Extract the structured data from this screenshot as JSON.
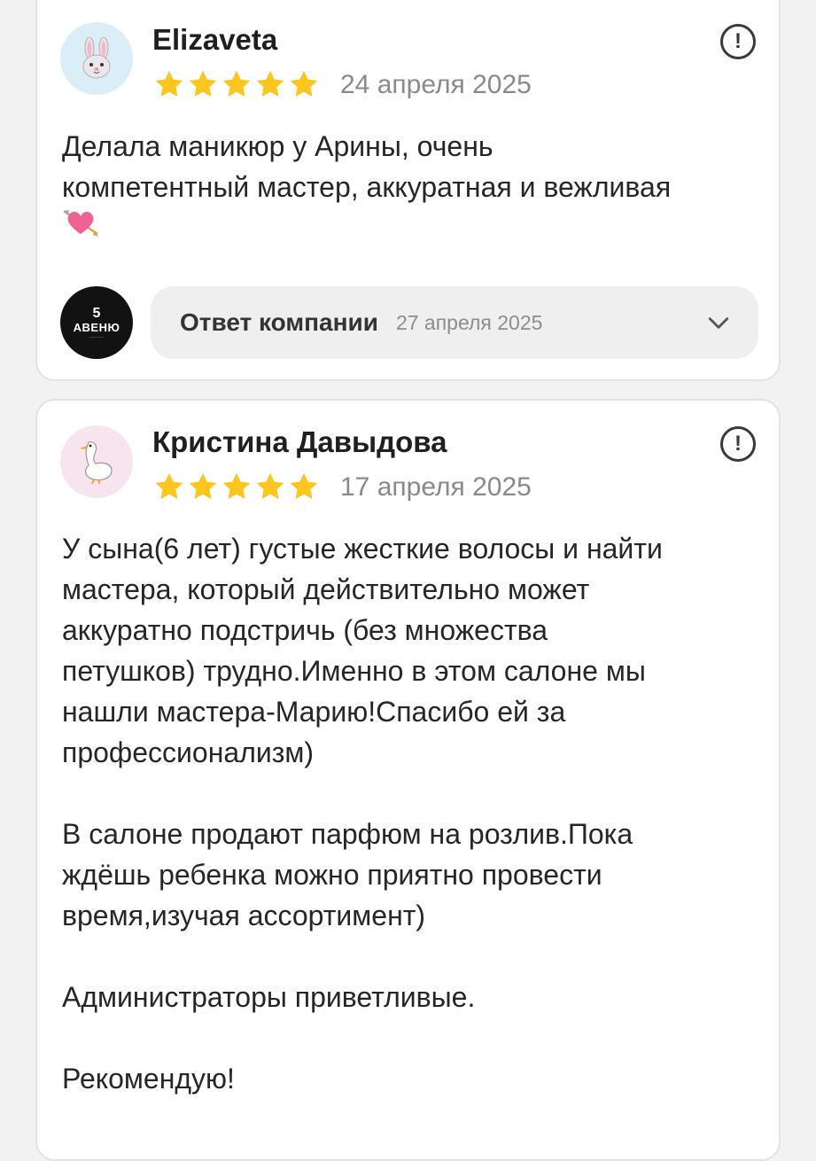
{
  "colors": {
    "star": "#fcc61e",
    "card_bg": "#ffffff",
    "page_bg": "#f2f2f2",
    "reply_bg": "#efefef"
  },
  "reviews": [
    {
      "author": "Elizaveta",
      "avatar_icon": "bunny-face",
      "rating": 5,
      "date": "24 апреля 2025",
      "text": "Делала маникюр у Арины, очень\nкомпетентный мастер, аккуратная и вежливая",
      "emoji": "heart-with-arrow",
      "reply": {
        "label": "Ответ компании",
        "date": "27 апреля 2025",
        "logo_number": "5",
        "logo_word": "АВЕНЮ"
      }
    },
    {
      "author": "Кристина Давыдова",
      "avatar_icon": "goose",
      "rating": 5,
      "date": "17 апреля 2025",
      "text": "У сына(6 лет) густые жесткие волосы и найти\nмастера, который действительно может\nаккуратно подстричь (без множества\nпетушков) трудно.Именно в этом салоне мы\nнашли мастера-Марию!Спасибо ей за\nпрофессионализм)\n\nВ салоне продают парфюм на розлив.Пока\nждёшь ребенка можно приятно провести\nвремя,изучая ассортимент)\n\nАдминистраторы приветливые.\n\nРекомендую!"
    }
  ]
}
